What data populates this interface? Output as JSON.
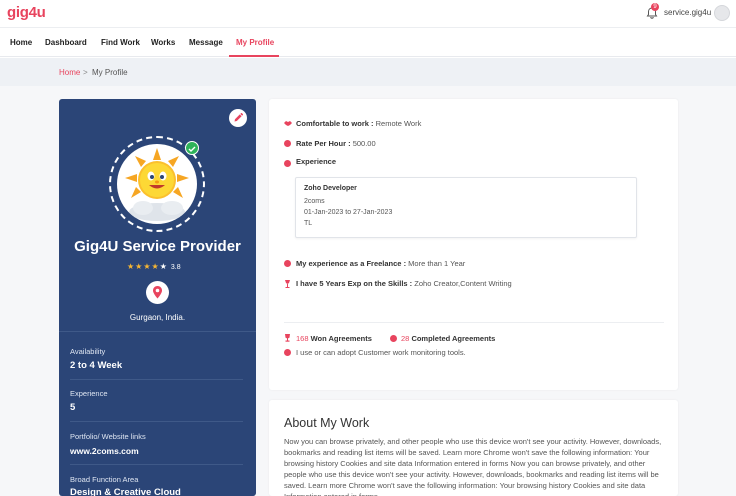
{
  "app": {
    "logo": "gig4u"
  },
  "header": {
    "notification_count": "9",
    "username": "service.gig4u"
  },
  "nav": {
    "items": [
      {
        "label": "Home"
      },
      {
        "label": "Dashboard"
      },
      {
        "label": "Find Work"
      },
      {
        "label": "Works"
      },
      {
        "label": "Message"
      },
      {
        "label": "My Profile"
      }
    ],
    "active_index": 5
  },
  "breadcrumb": {
    "home": "Home",
    "separator": ">",
    "current": "My Profile"
  },
  "profile": {
    "name": "Gig4U Service Provider",
    "rating": "3.8",
    "stars": 4,
    "location": "Gurgaon, India.",
    "fields": [
      {
        "label": "Availability",
        "value": "2 to 4 Week"
      },
      {
        "label": "Experience",
        "value": "5"
      },
      {
        "label": "Portfolio/ Website links",
        "value": "www.2coms.com"
      },
      {
        "label": "Broad Function Area",
        "value": "Design & Creative Cloud"
      }
    ]
  },
  "details": {
    "comfortable_label": "Comfortable to work :",
    "comfortable_value": "Remote Work",
    "rate_label": "Rate Per Hour :",
    "rate_value": "500.00",
    "experience_title": "Experience",
    "experience_entry": {
      "title": "Zoho Developer",
      "company": "2coms",
      "dates": "01-Jan-2023 to 27-Jan-2023",
      "location": "TL"
    },
    "freelance_label": "My experience as a Freelance :",
    "freelance_value": "More than 1 Year",
    "skills_label": "I have 5 Years Exp on the Skills :",
    "skills_value": "Zoho Creator,Content Writing",
    "won_count": "168",
    "won_label": "Won Agreements",
    "completed_count": "28",
    "completed_label": "Completed Agreements",
    "monitoring_text": "I use or can adopt Customer work monitoring tools."
  },
  "about": {
    "title": "About My Work",
    "text": "Now you can browse privately, and other people who use this device won't see your activity. However, downloads, bookmarks and reading list items will be saved. Learn more Chrome won't save the following information: Your browsing history Cookies and site data Information entered in forms Now you can browse privately, and other people who use this device won't see your activity. However, downloads, bookmarks and reading list items will be saved. Learn more Chrome won't save the following information: Your browsing history Cookies and site data Information entered in forms"
  },
  "colors": {
    "accent": "#e8445e",
    "sidebar": "#2b4577",
    "star": "#f7b733",
    "verified": "#2fb35a"
  }
}
